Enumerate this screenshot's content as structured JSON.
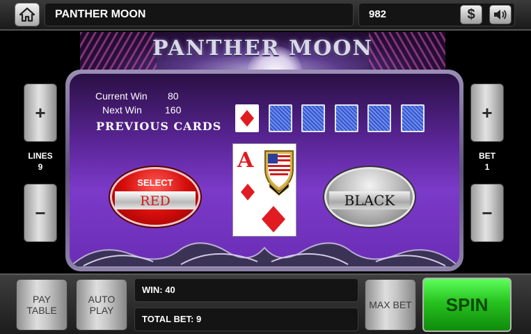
{
  "header": {
    "home_icon": "home-icon",
    "game_title": "PANTHER MOON",
    "credits": "982",
    "cashier_label": "$",
    "sound_icon": "speaker-icon"
  },
  "banner": {
    "title": "PANTHER MOON"
  },
  "left_controls": {
    "plus_label": "+",
    "minus_label": "−",
    "lines_label": "LINES",
    "lines_value": "9"
  },
  "right_controls": {
    "plus_label": "+",
    "minus_label": "−",
    "bet_label": "BET",
    "bet_value": "1"
  },
  "gamble": {
    "current_win_label": "Current Win",
    "current_win_value": "80",
    "next_win_label": "Next Win",
    "next_win_value": "160",
    "previous_cards_label": "PREVIOUS CARDS",
    "previous_cards": [
      {
        "suit": "diamond",
        "face_up": true
      },
      {
        "face_up": false
      },
      {
        "face_up": false
      },
      {
        "face_up": false
      },
      {
        "face_up": false
      },
      {
        "face_up": false
      }
    ],
    "current_card": {
      "rank": "A",
      "suit": "diamond",
      "suit_color": "#e11b22"
    },
    "red_button": {
      "select_label": "SELECT",
      "label": "RED"
    },
    "black_button": {
      "label": "BLACK"
    }
  },
  "footer": {
    "paytable_label": "PAY TABLE",
    "autoplay_label": "AUTO PLAY",
    "win_text": "WIN: 40",
    "total_bet_text": "TOTAL BET: 9",
    "maxbet_label": "MAX BET",
    "spin_label": "SPIN"
  },
  "colors": {
    "spin_green": "#27c21f",
    "red_button": "#d60e0b",
    "panel_purple": "#7b3ac9"
  }
}
